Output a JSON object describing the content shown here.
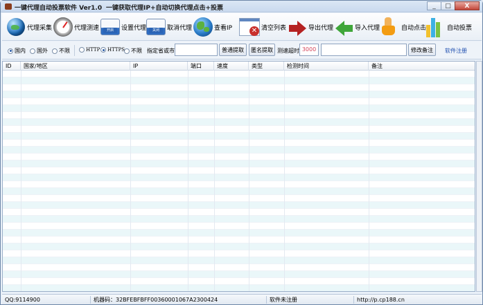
{
  "window": {
    "title": "一键代理自动投票软件 Ver1.0",
    "subtitle": "一键获取代理IP+自动切换代理点击+投票",
    "controls": [
      "_",
      "□",
      "X"
    ]
  },
  "toolbar": {
    "items": [
      {
        "label": "代理采集",
        "icon": "globe-icon"
      },
      {
        "label": "代理测速",
        "icon": "gauge-icon"
      },
      {
        "label": "设置代理",
        "icon": "window-open-icon",
        "badge": "开启"
      },
      {
        "label": "取消代理",
        "icon": "window-close-icon",
        "badge": "关闭"
      },
      {
        "label": "查看IP",
        "icon": "earth-icon"
      },
      {
        "label": "清空列表",
        "icon": "clear-list-icon"
      },
      {
        "label": "导出代理",
        "icon": "export-arrow-icon"
      },
      {
        "label": "导入代理",
        "icon": "import-arrow-icon"
      },
      {
        "label": "自动点击",
        "icon": "hand-click-icon"
      },
      {
        "label": "自动投票",
        "icon": "bar-chart-icon"
      }
    ]
  },
  "filters": {
    "region": {
      "options": [
        "国内",
        "国外",
        "不限"
      ],
      "selected": "国内"
    },
    "protocol": {
      "options": [
        "HTTP",
        "HTTPS",
        "不限"
      ],
      "selected": "HTTPS"
    },
    "city_label": "指定省或市",
    "city_value": "",
    "normal_fetch": "普通提取",
    "anon_fetch": "匿名提取",
    "timeout_label": "测速超时",
    "timeout_value": "3000",
    "note_value": "",
    "edit_note": "修改备注",
    "register": "软件注册"
  },
  "table": {
    "columns": [
      "ID",
      "国家/地区",
      "IP",
      "端口",
      "速度",
      "类型",
      "检测时间",
      "备注"
    ],
    "rows": []
  },
  "status": {
    "qq": "QQ:9114900",
    "machine": "机器码：32BFEBFBFF00360001067A2300424",
    "reg": "软件未注册",
    "site": "http://p.cp188.cn"
  },
  "colors": {
    "accent": "#2050b0",
    "row_alt": "#eaf7f9",
    "close_button": "#c3473a"
  }
}
